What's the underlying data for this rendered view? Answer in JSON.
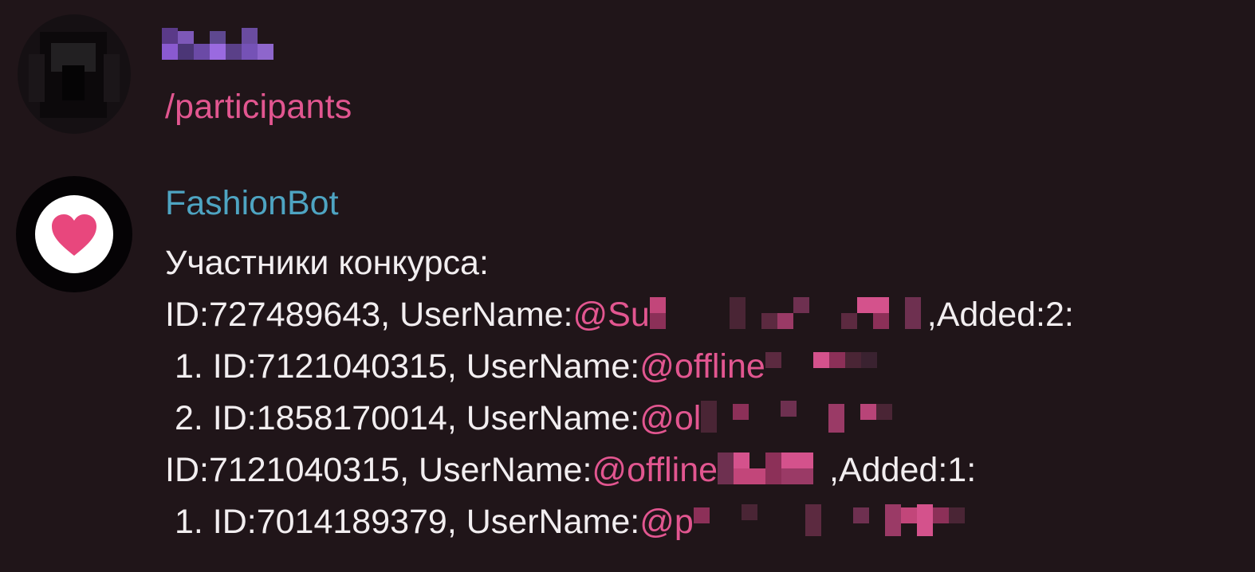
{
  "messages": [
    {
      "sender": "",
      "text": "/participants",
      "avatar": "user-avatar-pixelated"
    },
    {
      "sender": "FashionBot",
      "avatar": "heart-icon",
      "title": "Участники конкурса:",
      "lines": [
        {
          "prefix": "ID:727489643, UserName:",
          "mention": "@Su",
          "suffix": ",Added:2:"
        },
        {
          "prefix": " 1. ID:7121040315, UserName:",
          "mention": "@offline",
          "suffix": ""
        },
        {
          "prefix": " 2. ID:1858170014, UserName:",
          "mention": "@ol",
          "suffix": ""
        },
        {
          "prefix": "ID:7121040315, UserName:",
          "mention": "@offline",
          "suffix": ",Added:1:"
        },
        {
          "prefix": " 1. ID:7014189379, UserName:",
          "mention": "@p",
          "suffix": ""
        }
      ]
    }
  ],
  "colors": {
    "background": "#201519",
    "mention": "#e25690",
    "bot_name": "#4ea4c2",
    "text": "#f2eef0",
    "heart": "#e8477d"
  }
}
